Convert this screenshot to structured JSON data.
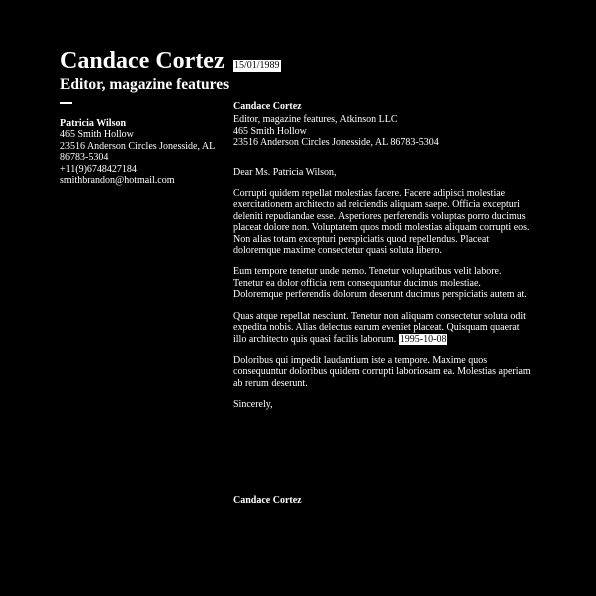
{
  "sender": {
    "name": "Candace Cortez",
    "title": "Editor, magazine features"
  },
  "recipient": {
    "name": "Patricia Wilson",
    "address_line1": "465 Smith Hollow",
    "address_line2": "23516 Anderson Circles Jonesside, AL",
    "address_line3": "86783-5304",
    "phone": "+11(9)6748427184",
    "email": "smithbrandon@hotmail.com"
  },
  "letter": {
    "date": "15/01/1989",
    "writer_name": "Candace Cortez",
    "writer_title_company": "Editor, magazine features, Atkinson LLC",
    "writer_address_line1": "465 Smith Hollow",
    "writer_address_line2": "23516 Anderson Circles Jonesside, AL 86783-5304",
    "salutation": "Dear Ms. Patricia Wilson,",
    "paragraph1": "Corrupti quidem repellat molestias facere. Facere adipisci molestiae exercitationem architecto ad reiciendis aliquam saepe. Officia excepturi deleniti repudiandae esse. Asperiores perferendis voluptas porro ducimus placeat dolore non. Voluptatem quos modi molestias aliquam corrupti eos. Non alias totam excepturi perspiciatis quod repellendus. Placeat doloremque maxime consectetur quasi soluta libero.",
    "paragraph2": "Eum tempore tenetur unde nemo. Tenetur voluptatibus velit labore. Tenetur ea dolor officia rem consequuntur ducimus molestiae. Doloremque perferendis dolorum deserunt ducimus perspiciatis autem at.",
    "paragraph3_text": "Quas atque repellat nesciunt. Tenetur non aliquam consectetur soluta odit expedita nobis. Alias delectus earum eveniet placeat. Quisquam quaerat illo architecto quis quasi facilis laborum.",
    "paragraph3_date": "1995-10-08",
    "paragraph4": "Doloribus qui impedit laudantium iste a tempore. Maxime quos consequuntur doloribus quidem corrupti laboriosam ea. Molestias aperiam ab rerum deserunt.",
    "closing": "Sincerely,",
    "signature_name": "Candace Cortez"
  },
  "colors": {
    "background": "#000000",
    "text": "#ffffff",
    "highlight_bg": "#ffffff",
    "highlight_text": "#000000"
  }
}
